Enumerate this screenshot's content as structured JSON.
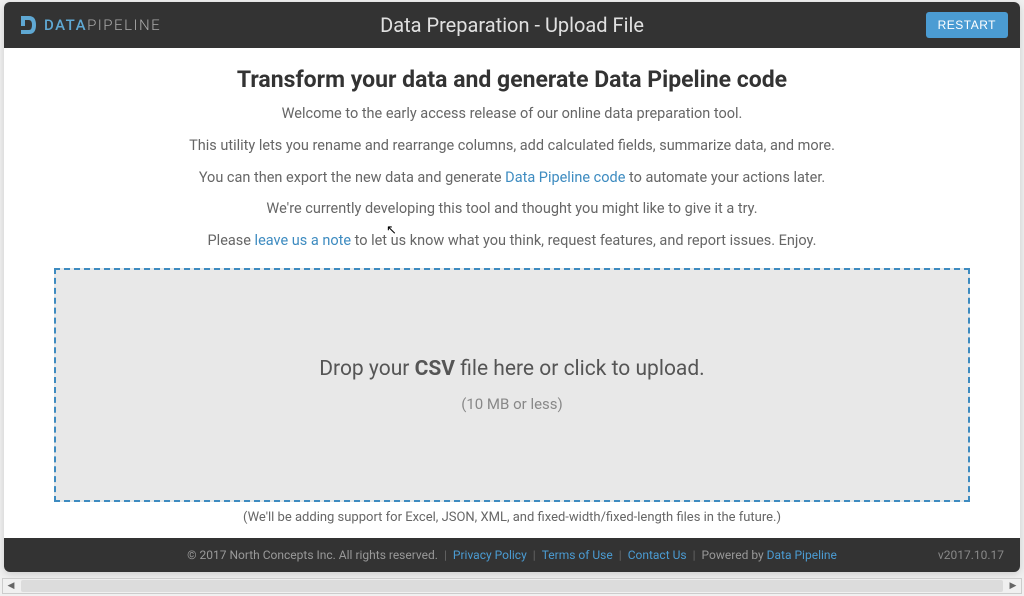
{
  "header": {
    "logo_data": "DATA",
    "logo_pipeline": "PIPELINE",
    "title": "Data Preparation - Upload File",
    "restart_label": "RESTART"
  },
  "content": {
    "title": "Transform your data and generate Data Pipeline code",
    "line1": "Welcome to the early access release of our online data preparation tool.",
    "line2": "This utility lets you rename and rearrange columns, add calculated fields, summarize data, and more.",
    "line3_pre": "You can then export the new data and generate ",
    "line3_link": "Data Pipeline code",
    "line3_post": " to automate your actions later.",
    "line4": "We're currently developing this tool and thought you might like to give it a try.",
    "line5_pre": "Please ",
    "line5_link": "leave us a note",
    "line5_post": " to let us know what you think, request features, and report issues. Enjoy.",
    "drop_main_pre": "Drop your ",
    "drop_main_bold": "CSV",
    "drop_main_post": " file here or click to upload.",
    "drop_sub": "(10 MB or less)",
    "future_note": "(We'll be adding support for Excel, JSON, XML, and fixed-width/fixed-length files in the future.)"
  },
  "footer": {
    "copyright": "© 2017 North Concepts Inc.   All rights reserved.",
    "privacy": "Privacy Policy",
    "terms": "Terms of Use",
    "contact": "Contact Us",
    "powered_pre": "Powered by ",
    "powered_link": "Data Pipeline",
    "version": "v2017.10.17"
  }
}
